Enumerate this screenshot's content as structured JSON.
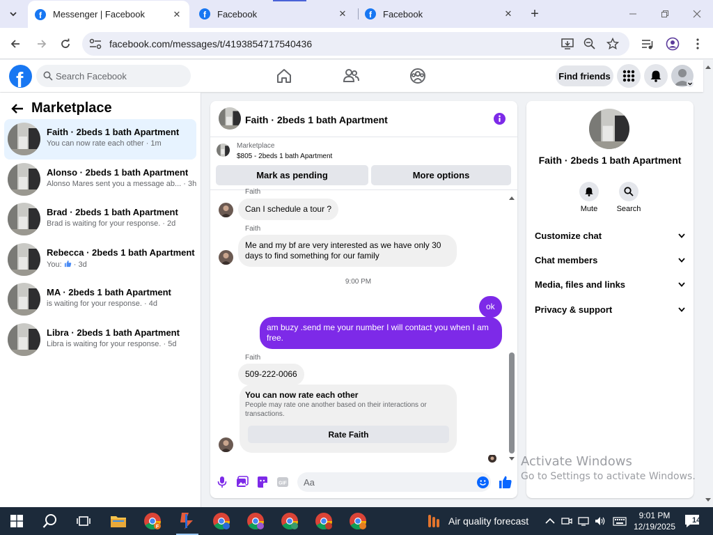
{
  "browser": {
    "tabs": [
      {
        "title": "Messenger | Facebook",
        "active": true
      },
      {
        "title": "Facebook",
        "active": false
      },
      {
        "title": "Facebook",
        "active": false
      }
    ],
    "url": "facebook.com/messages/t/4193854717540436"
  },
  "header": {
    "logo_letter": "f",
    "search_placeholder": "Search Facebook",
    "find_friends": "Find friends",
    "nav_icons": [
      "home-icon",
      "friends-icon",
      "groups-icon"
    ],
    "accent": "#1877f2"
  },
  "sidebar": {
    "title": "Marketplace",
    "conversations": [
      {
        "name": "Faith · 2beds 1 bath Apartment",
        "snippet": "You can now rate each other · 1m",
        "selected": true
      },
      {
        "name": "Alonso · 2beds 1 bath Apartment",
        "snippet": "Alonso Mares sent you a message ab... · 3h",
        "selected": false
      },
      {
        "name": "Brad · 2beds 1 bath Apartment",
        "snippet": "Brad is waiting for your response. · 2d",
        "selected": false
      },
      {
        "name": "Rebecca · 2beds 1 bath Apartment",
        "snippet_prefix": "You:",
        "snippet": "· 3d",
        "selected": false
      },
      {
        "name": "MA · 2beds 1 bath Apartment",
        "snippet": "is waiting for your response. · 4d",
        "selected": false
      },
      {
        "name": "Libra · 2beds 1 bath Apartment",
        "snippet": "Libra is waiting for your response. · 5d",
        "selected": false
      }
    ]
  },
  "chat": {
    "title": "Faith · 2beds 1 bath Apartment",
    "marketplace_label": "Marketplace",
    "listing": "$805 - 2beds 1 bath Apartment",
    "mark_pending": "Mark as pending",
    "more_options": "More options",
    "messages": {
      "sender_top": "Faith",
      "m1": "Can I schedule a tour ?",
      "sender2": "Faith",
      "m2": "Me and my bf are very interested as we have only 30 days to find something for our family",
      "time": "9:00 PM",
      "out1": "ok",
      "out2": "am buzy .send me your number I will contact you when I am free.",
      "sender3": "Faith",
      "m3": "509-222-0066"
    },
    "rate": {
      "title": "You can now rate each other",
      "subtitle": "People may rate one another based on their interactions or transactions.",
      "button": "Rate Faith"
    },
    "composer_placeholder": "Aa",
    "outgoing_color": "#7d2ae8"
  },
  "info_panel": {
    "title": "Faith · 2beds 1 bath Apartment",
    "mute": "Mute",
    "search": "Search",
    "sections": [
      "Customize chat",
      "Chat members",
      "Media, files and links",
      "Privacy & support"
    ]
  },
  "watermark": {
    "line1": "Activate Windows",
    "line2": "Go to Settings to activate Windows."
  },
  "taskbar": {
    "weather": "Air quality forecast",
    "time": "9:01 PM",
    "date": "12/19/2025",
    "notifications": "14"
  }
}
